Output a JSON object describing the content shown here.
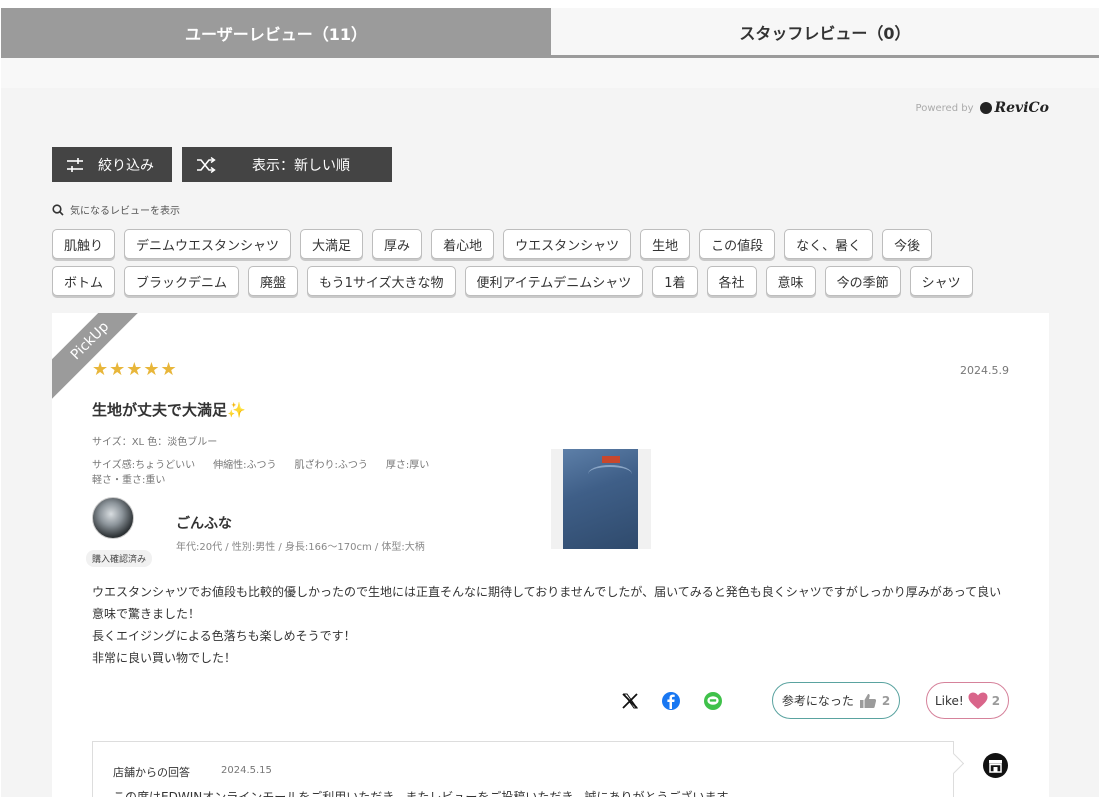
{
  "tabs": {
    "user": "ユーザーレビュー（11）",
    "staff": "スタッフレビュー（0）"
  },
  "powered": {
    "label": "Powered by",
    "brand": "ReviCo"
  },
  "buttons": {
    "filter": "絞り込み",
    "sort": "表示：新しい順"
  },
  "search_label": "気になるレビューを表示",
  "tags_row1": [
    "肌触り",
    "デニムウエスタンシャツ",
    "大満足",
    "厚み",
    "着心地",
    "ウエスタンシャツ",
    "生地",
    "この値段",
    "なく、暑く",
    "今後"
  ],
  "tags_row2": [
    "ボトム",
    "ブラックデニム",
    "廃盤",
    "もう1サイズ大きな物",
    "便利アイテムデニムシャツ",
    "1着",
    "各社",
    "意味",
    "今の季節",
    "シャツ"
  ],
  "review": {
    "pickup": "PickUp",
    "stars": "★★★★★",
    "rating": 5,
    "date": "2024.5.9",
    "title": "生地が丈夫で大満足",
    "title_emoji": "✨",
    "size_info": "サイズ：XL 色：淡色ブルー",
    "attrs": [
      "サイズ感:ちょうどいい",
      "伸縮性:ふつう",
      "肌ざわり:ふつう",
      "厚さ:厚い",
      "軽さ・重さ:重い"
    ],
    "badge": "購入確認済み",
    "username": "ごんふな",
    "profile": "年代:20代 / 性別:男性 / 身長:166〜170cm / 体型:大柄",
    "body": [
      "ウエスタンシャツでお値段も比較的優しかったので生地には正直そんなに期待しておりませんでしたが、届いてみると発色も良くシャツですがしっかり厚みがあって良い",
      "意味で驚きました！",
      "長くエイジングによる色落ちも楽しめそうです！",
      "非常に良い買い物でした！"
    ],
    "helpful_label": "参考になった",
    "helpful_count": "2",
    "like_label": "Like!",
    "like_count": "2"
  },
  "reply": {
    "head": "店舗からの回答",
    "date": "2024.5.15",
    "text": "この度はEDWINオンラインモールをご利用いただき、またレビューをご投稿いただき、誠にありがとうございます。"
  },
  "colors": {
    "tab_active": "#9b9b9b",
    "button_dark": "#444444",
    "star": "#e8b63a",
    "helpful_border": "#5aa3a0",
    "like_border": "#d6829b",
    "heart": "#d9658a",
    "facebook": "#1877f2",
    "line": "#3fc14a"
  },
  "icons": {
    "filter": "sliders-icon",
    "sort": "shuffle-icon",
    "search": "search-icon",
    "x": "x-logo-icon",
    "facebook": "facebook-icon",
    "line": "line-icon",
    "thumb": "thumbs-up-icon",
    "heart": "heart-icon",
    "shop": "shop-icon"
  }
}
